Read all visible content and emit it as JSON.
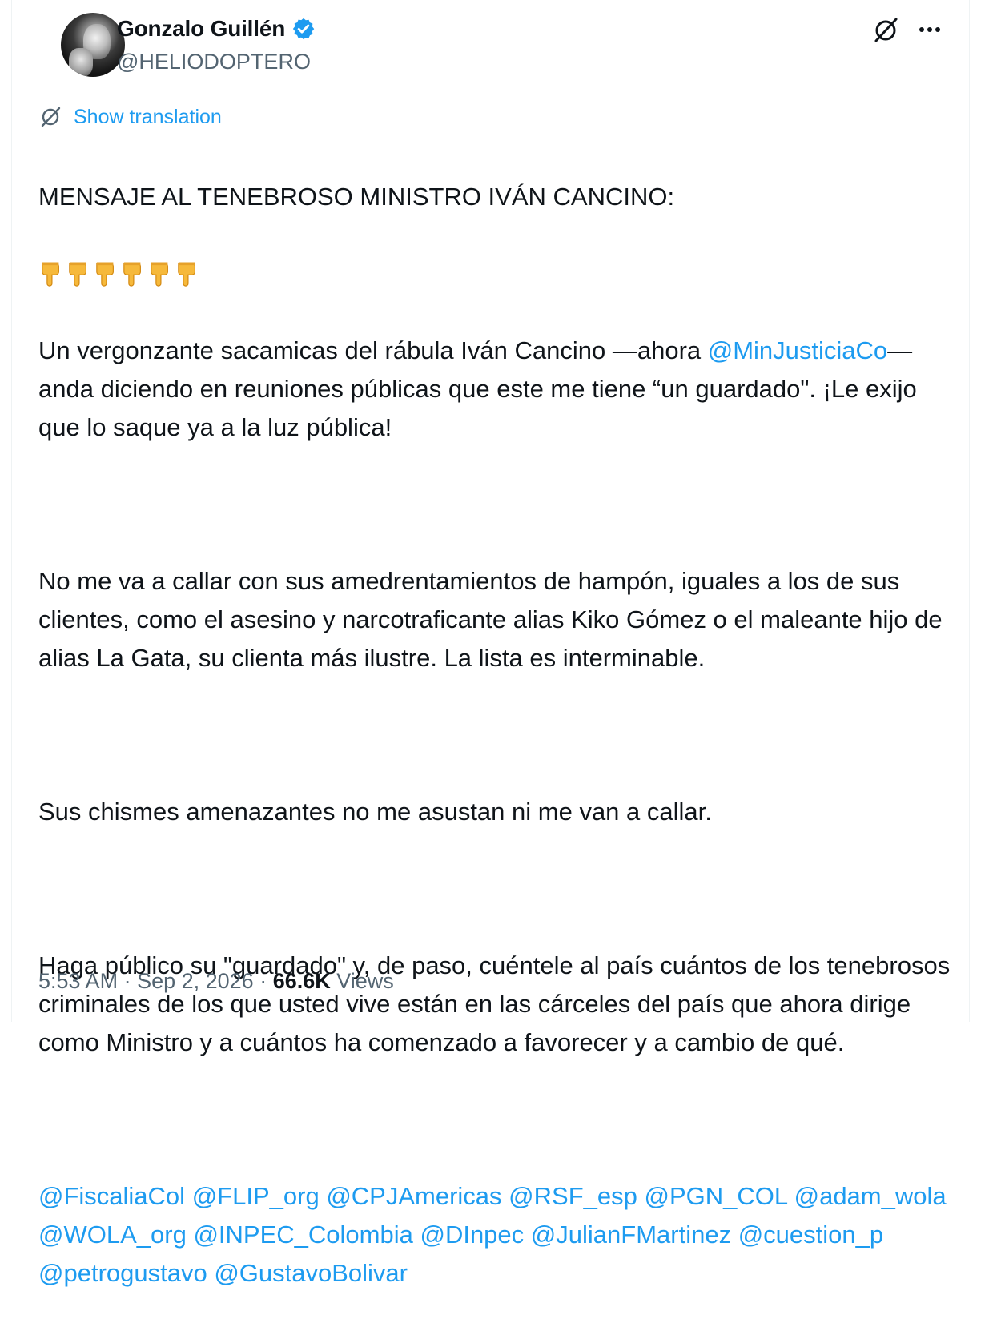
{
  "author": {
    "display_name": "Gonzalo Guillén",
    "handle": "@HELIODOPTERO",
    "verified": true
  },
  "header_icons": [
    "grok-icon",
    "more-icon"
  ],
  "translate": {
    "label": "Show translation"
  },
  "tweet": {
    "line1": "MENSAJE AL TENEBROSO MINISTRO IVÁN CANCINO:",
    "emoji_count": 6,
    "emoji_name": "backhand-index-pointing-down",
    "p1_before": "Un vergonzante sacamicas del rábula Iván Cancino —ahora ",
    "p1_mention": "@MinJusticiaCo",
    "p1_after": "— anda diciendo en reuniones públicas que este me tiene “un  guardado\". ¡Le exijo que lo saque ya a la luz pública!",
    "p2": "No me va a callar con sus amedrentamientos de hampón, iguales a los de sus clientes, como el asesino y narcotraficante alias Kiko Gómez o el maleante hijo de alias La Gata, su clienta más ilustre. La lista es interminable.",
    "p3": "Sus chismes amenazantes no me asustan ni me van a callar.",
    "p4": "Haga público su \"guardado\" y, de paso, cuéntele al país cuántos de los tenebrosos criminales de los que usted vive están en las cárceles del país que ahora dirige como Ministro y a cuántos ha comenzado a favorecer y a cambio de qué.",
    "mentions": [
      "@FiscaliaCol",
      "@FLIP_org",
      "@CPJAmericas",
      "@RSF_esp",
      "@PGN_COL",
      "@adam_wola",
      "@WOLA_org",
      "@INPEC_Colombia",
      "@DInpec",
      "@JulianFMartinez",
      "@cuestion_p",
      "@petrogustavo",
      "@GustavoBolivar"
    ]
  },
  "meta": {
    "time": "5:53 AM",
    "separator": " · ",
    "date": "Sep 2, 2026",
    "views_count": "66.6K",
    "views_label": " Views"
  },
  "colors": {
    "link": "#1d9bf0",
    "secondary": "#536471",
    "text": "#0f1419",
    "emoji": "#f6b93b"
  }
}
